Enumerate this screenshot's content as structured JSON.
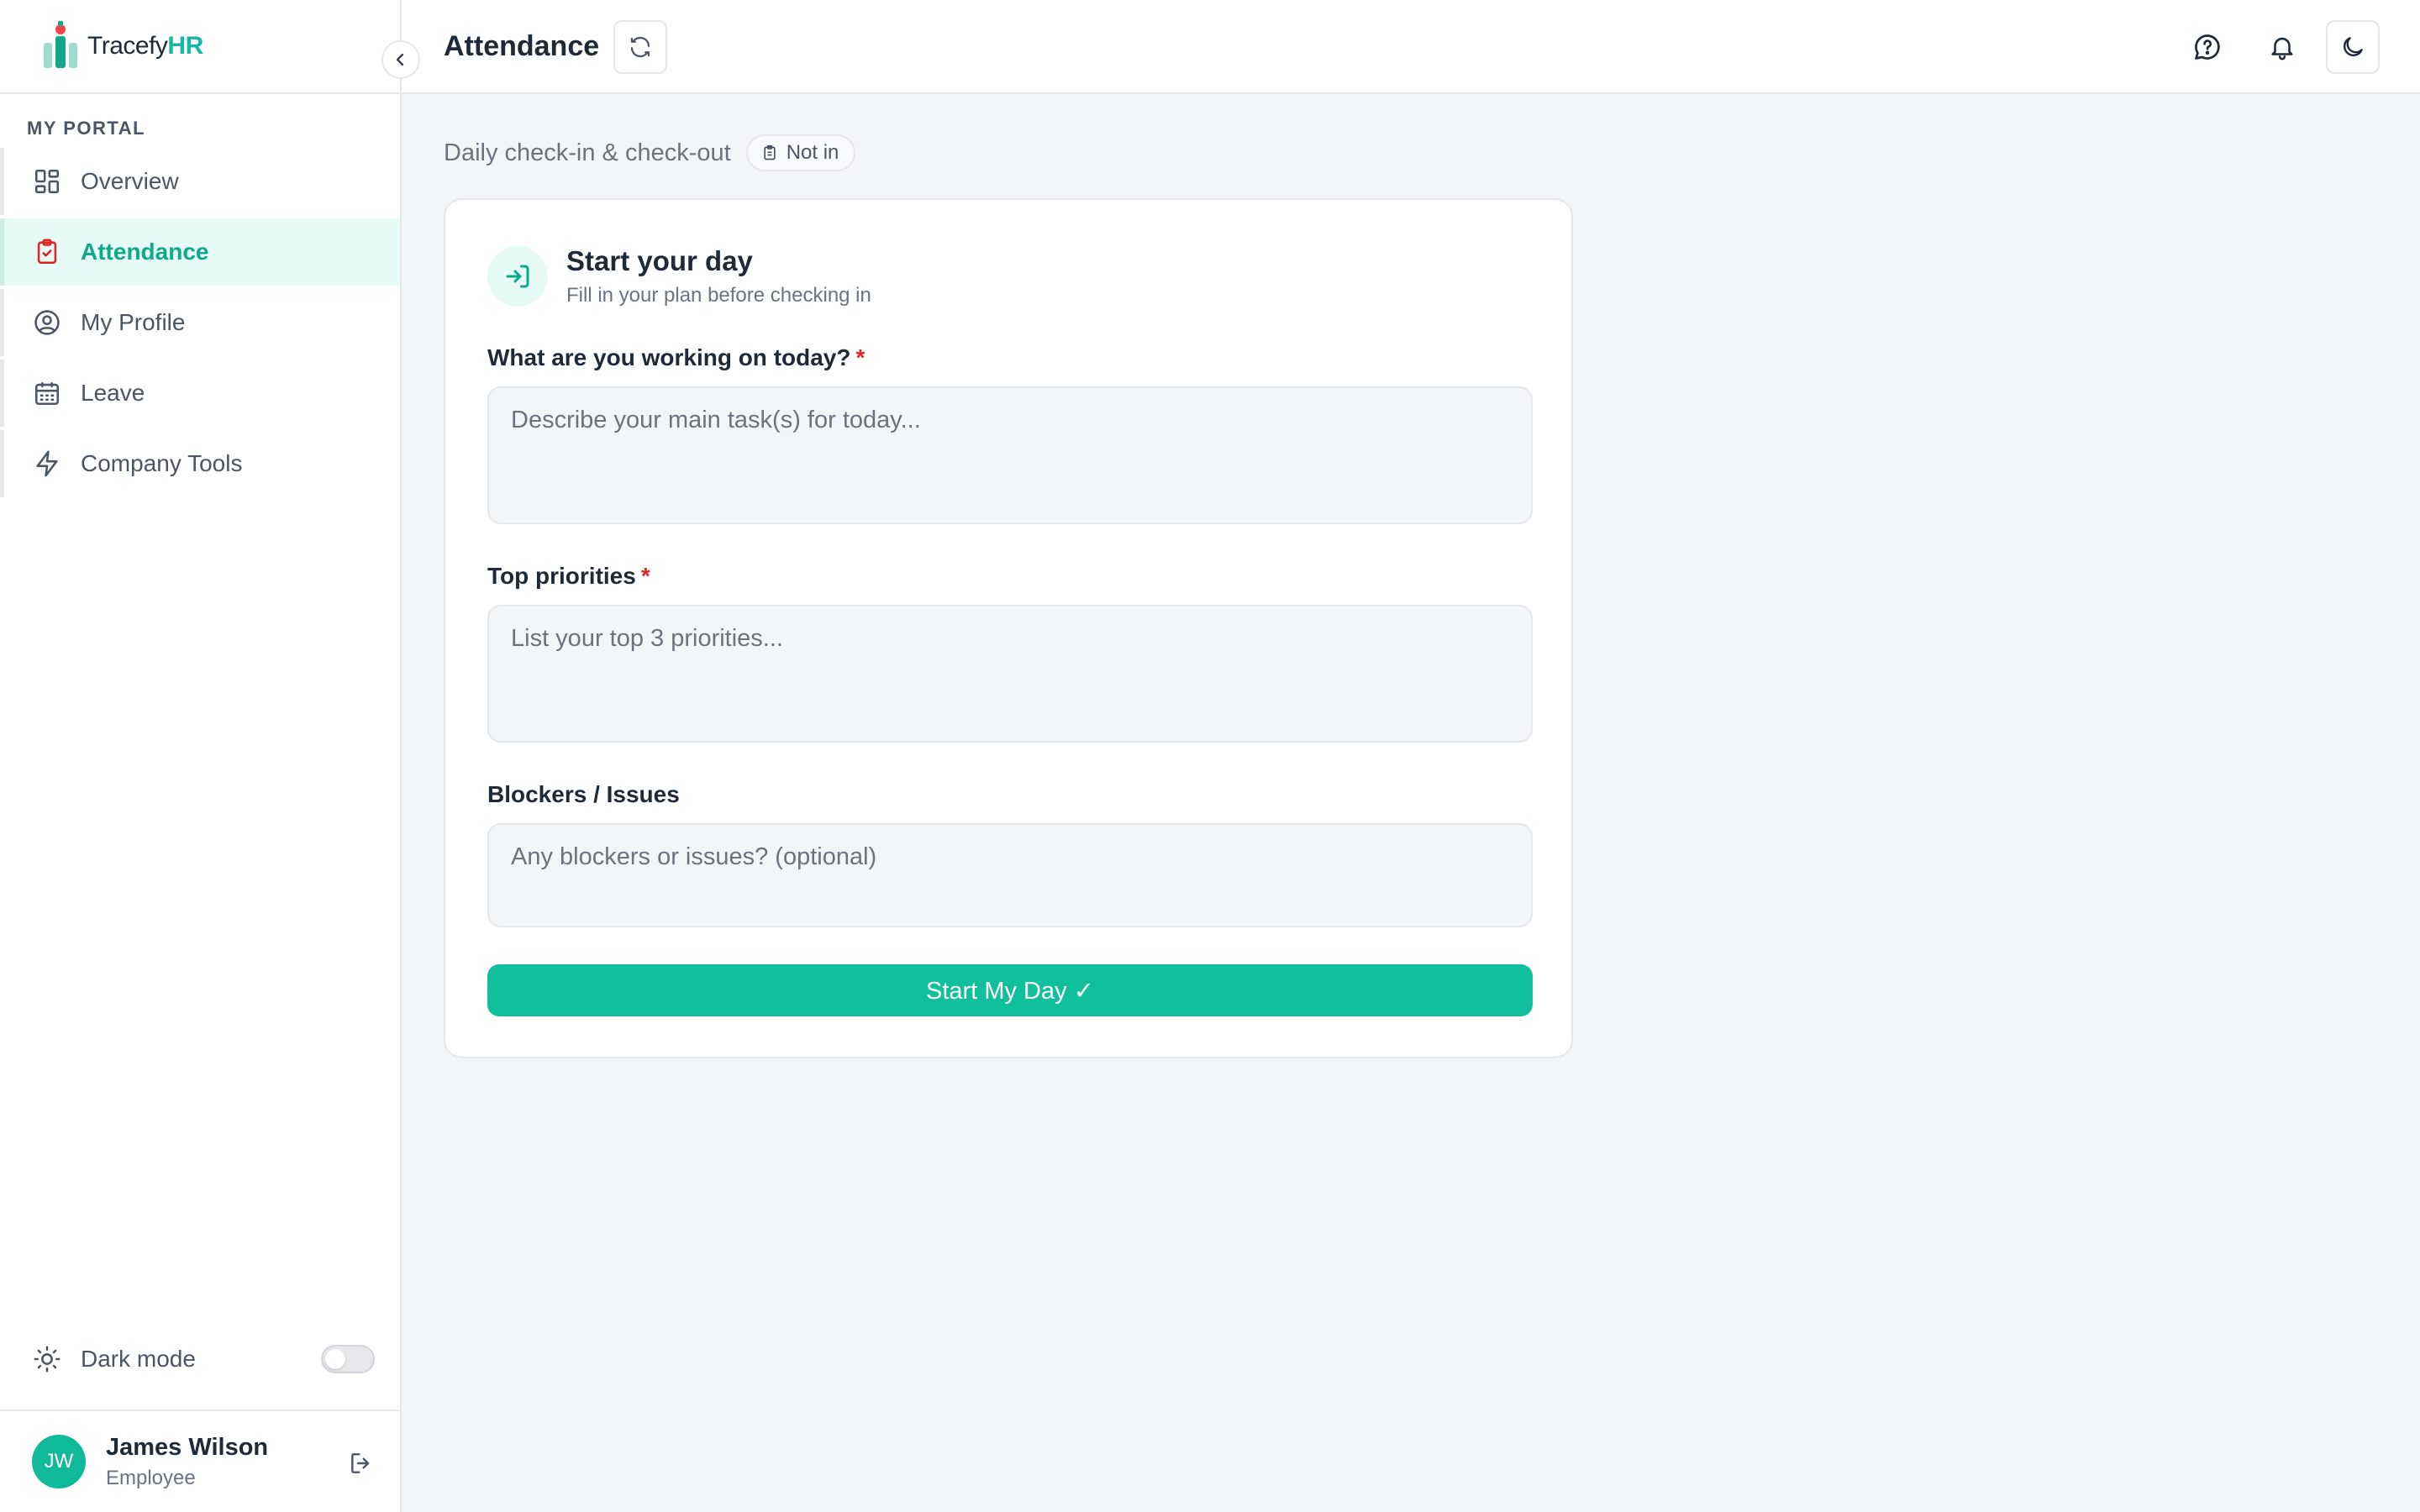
{
  "brand": {
    "name_prefix": "Tracefy",
    "name_suffix": "HR"
  },
  "sidebar": {
    "section_label": "MY PORTAL",
    "items": [
      {
        "label": "Overview",
        "icon": "grid-icon",
        "active": false
      },
      {
        "label": "Attendance",
        "icon": "clipboard-icon",
        "active": true
      },
      {
        "label": "My Profile",
        "icon": "user-circle-icon",
        "active": false
      },
      {
        "label": "Leave",
        "icon": "calendar-icon",
        "active": false
      },
      {
        "label": "Company Tools",
        "icon": "lightning-icon",
        "active": false
      }
    ],
    "dark_mode_label": "Dark mode",
    "dark_mode_on": false
  },
  "user": {
    "initials": "JW",
    "name": "James Wilson",
    "role": "Employee"
  },
  "header": {
    "title": "Attendance"
  },
  "main": {
    "subheader": "Daily check-in & check-out",
    "status_badge": "Not in",
    "card": {
      "title": "Start your day",
      "subtitle": "Fill in your plan before checking in",
      "fields": [
        {
          "label": "What are you working on today?",
          "required_mark": "*",
          "placeholder": "Describe your main task(s) for today..."
        },
        {
          "label": "Top priorities",
          "required_mark": "*",
          "placeholder": "List your top 3 priorities..."
        },
        {
          "label": "Blockers / Issues",
          "required_mark": "",
          "placeholder": "Any blockers or issues? (optional)"
        }
      ],
      "submit_label": "Start My Day ✓"
    }
  },
  "colors": {
    "accent": "#10bf9c",
    "brand_hr": "#14b8a6",
    "active_bg": "#e6fbf6",
    "required": "#dc2626"
  }
}
